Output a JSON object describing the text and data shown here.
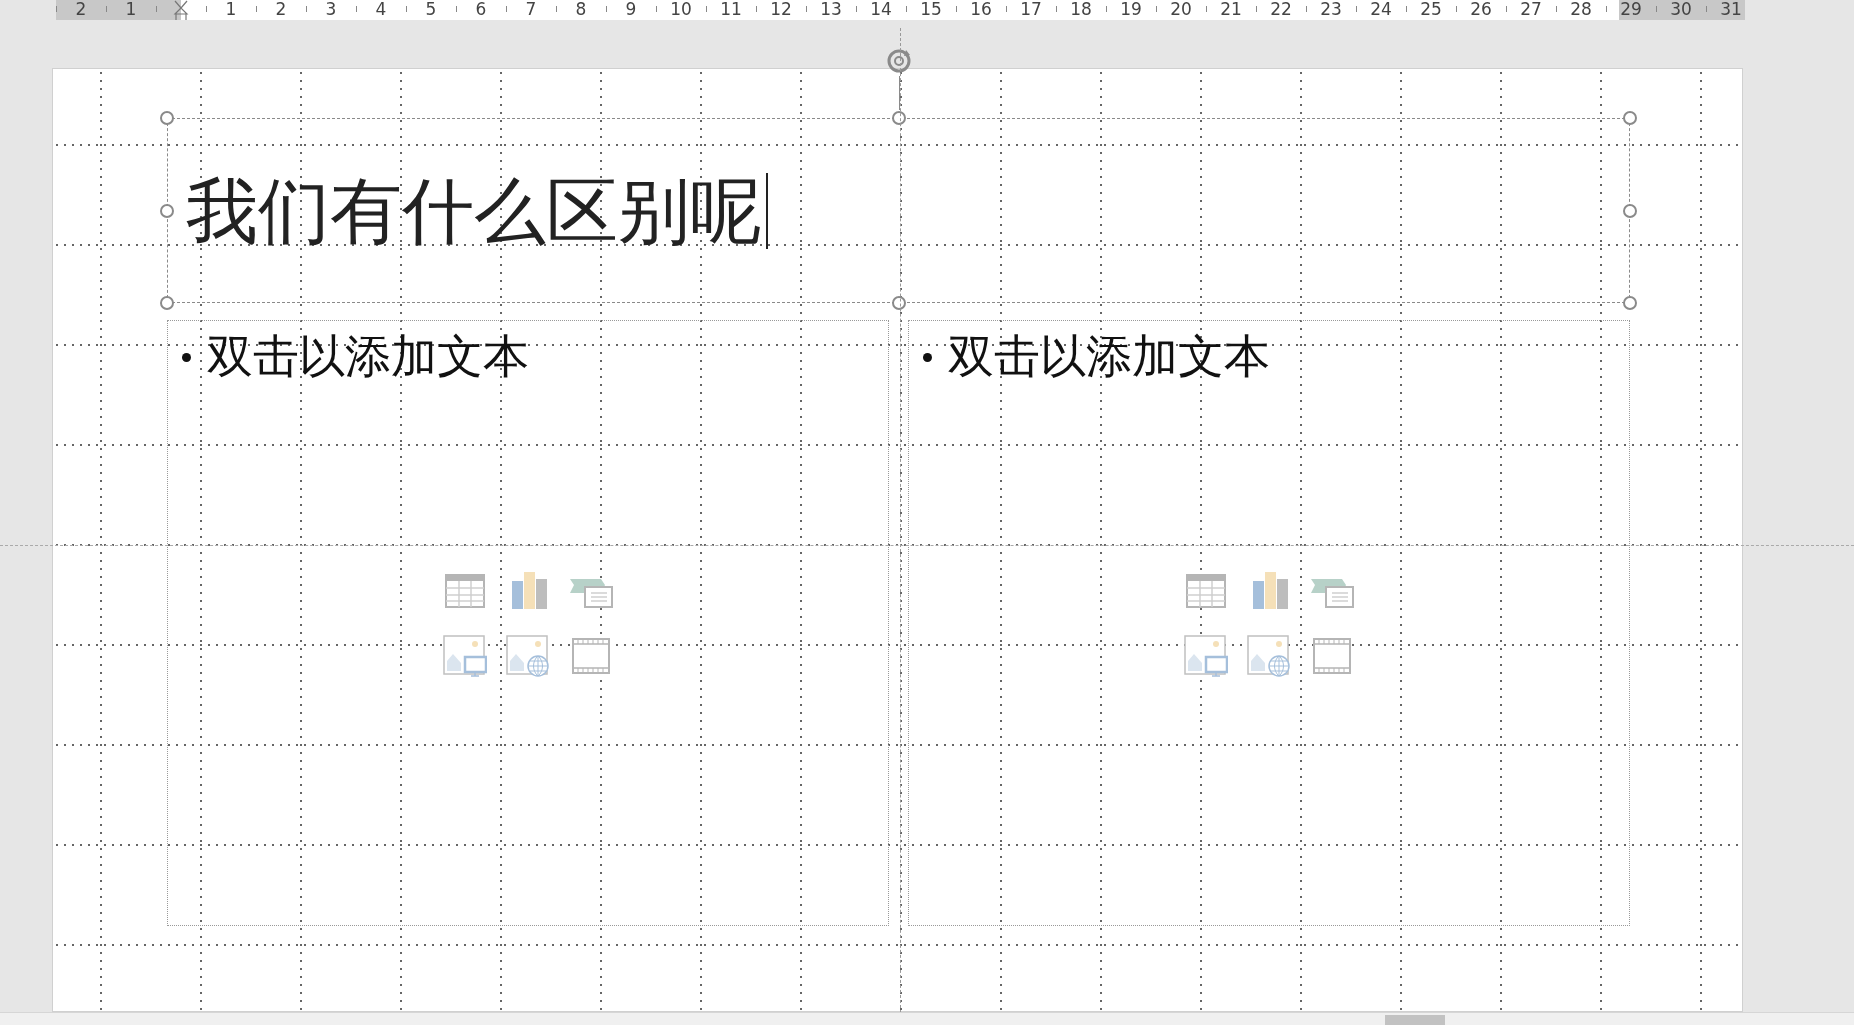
{
  "ruler": {
    "left_margin_labels": [
      "2",
      "1"
    ],
    "labels": [
      "1",
      "2",
      "3",
      "4",
      "5",
      "6",
      "7",
      "8",
      "9",
      "10",
      "11",
      "12",
      "13",
      "14",
      "15",
      "16",
      "17",
      "18",
      "19",
      "20",
      "21",
      "22",
      "23",
      "24",
      "25",
      "26",
      "27",
      "28"
    ],
    "right_margin_labels": [
      "29",
      "30",
      "31"
    ]
  },
  "slide": {
    "title": {
      "text": "我们有什么区别呢",
      "selected": true,
      "caret_visible": true
    },
    "placeholders": [
      {
        "text": "双击以添加文本"
      },
      {
        "text": "双击以添加文本"
      }
    ]
  }
}
